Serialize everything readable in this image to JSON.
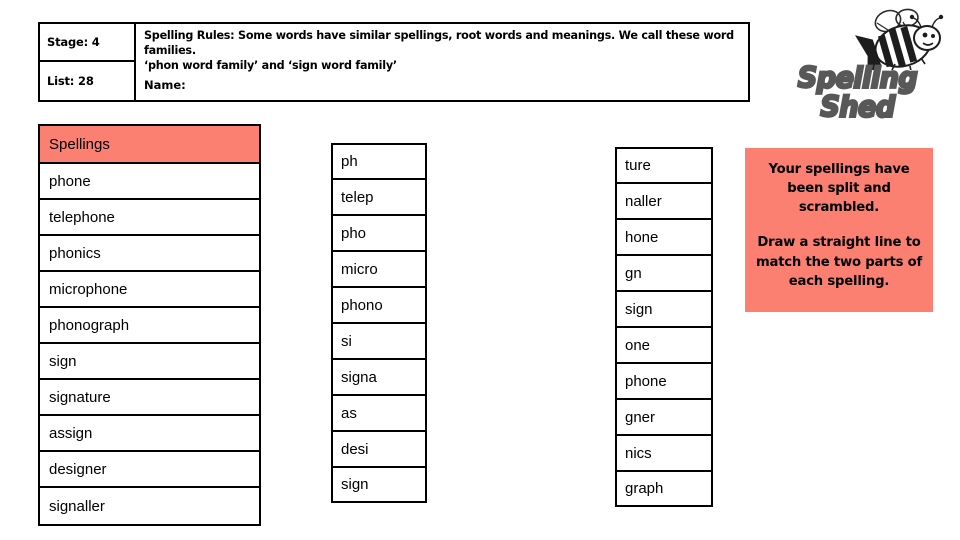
{
  "header": {
    "stage_label": "Stage: 4",
    "list_label": "List: 28",
    "spelling_rules": "Spelling Rules: Some words have similar spellings, root words and meanings. We call these word families.\n‘phon word family’ and ‘sign word family’",
    "name_label": "Name:"
  },
  "logo": {
    "wordmark": "Spelling Shed",
    "bee_icon": "bee-icon",
    "color": "#585858"
  },
  "spellings_table": {
    "header": "Spellings",
    "header_color": "#fb8072",
    "words": [
      "phone",
      "telephone",
      "phonics",
      "microphone",
      "phonograph",
      "sign",
      "signature",
      "assign",
      "designer",
      "signaller"
    ]
  },
  "scramble": {
    "left_parts": [
      "ph",
      "telep",
      "pho",
      "micro",
      "phono",
      "si",
      "signa",
      "as",
      "desi",
      "sign"
    ],
    "right_parts": [
      "ture",
      "naller",
      "hone",
      "gn",
      "sign",
      "one",
      "phone",
      "gner",
      "nics",
      "graph"
    ]
  },
  "instructions": {
    "background_color": "#fb8072",
    "paragraph_1": "Your spellings have been split and scrambled.",
    "paragraph_2": "Draw a straight line to match the two parts of each spelling."
  }
}
